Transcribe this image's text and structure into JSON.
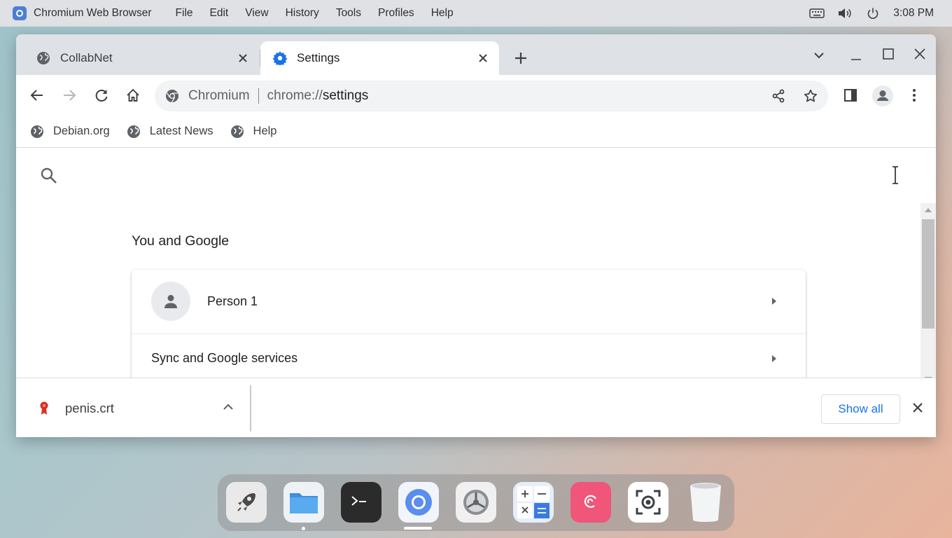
{
  "topbar": {
    "app_name": "Chromium Web Browser",
    "menus": [
      "File",
      "Edit",
      "View",
      "History",
      "Tools",
      "Profiles",
      "Help"
    ],
    "time": "3:08 PM",
    "tray_icons": [
      "keyboard-icon",
      "volume-icon",
      "power-icon"
    ]
  },
  "tabs": [
    {
      "title": "CollabNet",
      "icon": "globe-icon",
      "active": false
    },
    {
      "title": "Settings",
      "icon": "gear-icon",
      "active": true
    }
  ],
  "toolbar": {
    "omnibox_chip": "Chromium",
    "url_scheme": "chrome://",
    "url_path": "settings"
  },
  "bookmarks": [
    {
      "label": "Debian.org"
    },
    {
      "label": "Latest News"
    },
    {
      "label": "Help"
    }
  ],
  "settings": {
    "section_title": "You and Google",
    "rows": [
      {
        "label": "Person 1"
      },
      {
        "label": "Sync and Google services"
      }
    ]
  },
  "download": {
    "filename": "penis.crt",
    "show_all": "Show all"
  },
  "dock": {
    "apps": [
      "launcher-icon",
      "files-icon",
      "terminal-icon",
      "chromium-icon",
      "settings-icon",
      "calculator-icon",
      "debian-icon",
      "screenshot-icon",
      "trash-icon"
    ]
  },
  "colors": {
    "accent": "#1a73e8",
    "settings_blue": "#1a73e8",
    "cert_red": "#d93025"
  }
}
